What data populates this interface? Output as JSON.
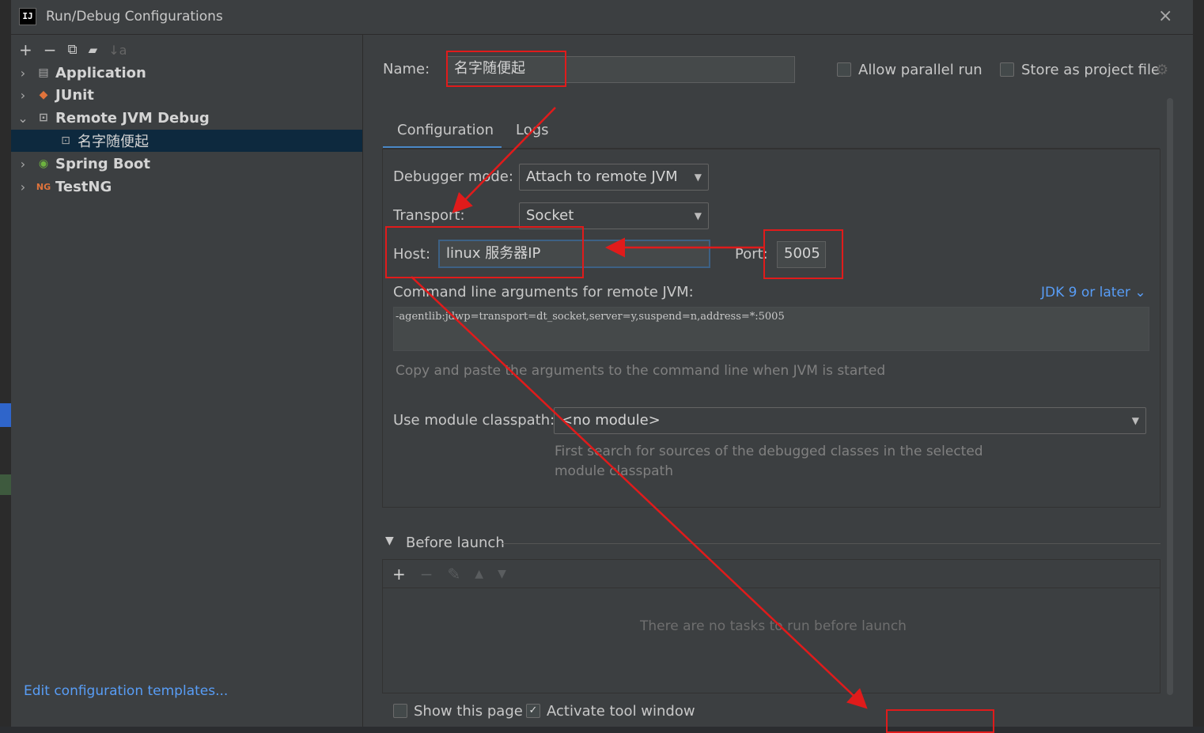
{
  "window": {
    "title": "Run/Debug Configurations",
    "logo_text": "IJ",
    "close_glyph": "×"
  },
  "toolbar": {
    "add_glyph": "+",
    "remove_glyph": "−",
    "copy_glyph": "⧉",
    "folder_glyph": "▰",
    "sort_glyph": "↓a"
  },
  "tree": {
    "items": [
      {
        "label": "Application",
        "icon": "application-icon",
        "glyph": "▤",
        "chevron": "›"
      },
      {
        "label": "JUnit",
        "icon": "junit-icon",
        "glyph": "◆",
        "chevron": "›"
      },
      {
        "label": "Remote JVM Debug",
        "icon": "remote-debug-icon",
        "glyph": "⊡",
        "chevron": "⌄"
      },
      {
        "label": "名字随便起",
        "icon": "remote-debug-icon",
        "glyph": "⊡",
        "chevron": ""
      },
      {
        "label": "Spring Boot",
        "icon": "spring-boot-icon",
        "glyph": "◉",
        "chevron": "›"
      },
      {
        "label": "TestNG",
        "icon": "testng-icon",
        "glyph": "NG",
        "chevron": "›"
      }
    ]
  },
  "left_footer": {
    "edit_templates": "Edit configuration templates..."
  },
  "name_row": {
    "label": "Name:",
    "value": "名字随便起",
    "allow_parallel": "Allow parallel run",
    "store_project": "Store as project file"
  },
  "tabs": [
    {
      "label": "Configuration"
    },
    {
      "label": "Logs"
    }
  ],
  "config": {
    "debugger_mode_label": "Debugger mode:",
    "debugger_mode_value": "Attach to remote JVM",
    "transport_label": "Transport:",
    "transport_value": "Socket",
    "host_label": "Host:",
    "host_value": "linux 服务器IP",
    "port_label": "Port:",
    "port_value": "5005",
    "cmd_label": "Command line arguments for remote JVM:",
    "jdk_link": "JDK 9 or later ⌄",
    "cmd_value": "-agentlib:jdwp=transport=dt_socket,server=y,suspend=n,address=*:5005",
    "cmd_hint": "Copy and paste the arguments to the command line when JVM is started",
    "module_label": "Use module classpath:",
    "module_value": "<no module>",
    "module_hint_1": "First search for sources of the debugged classes in the selected",
    "module_hint_2": "module classpath"
  },
  "before_launch": {
    "title": "Before launch",
    "empty_text": "There are no tasks to run before launch",
    "show_page": "Show this page",
    "activate_tool": "Activate tool window"
  },
  "colors": {
    "annotation_red": "#e01b1b",
    "accent_blue": "#4a88c7",
    "link_blue": "#589df6"
  }
}
